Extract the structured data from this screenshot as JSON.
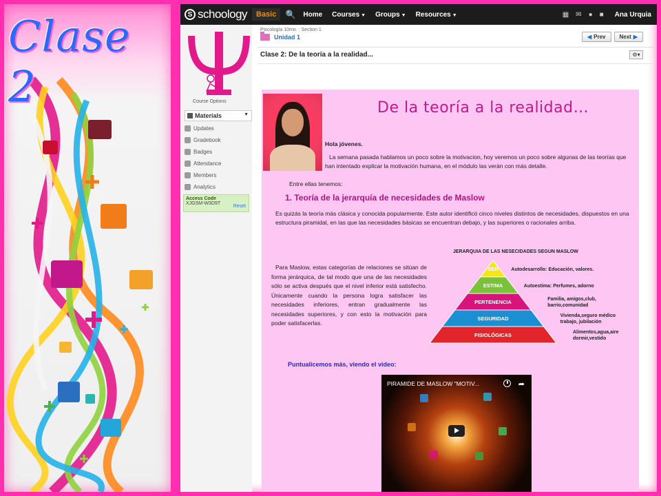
{
  "slide": {
    "title": "Clase 2"
  },
  "topbar": {
    "logo_mark": "S",
    "logo_text": "schoology",
    "basic_label": "Basic",
    "nav": [
      {
        "label": "Home",
        "has_caret": false
      },
      {
        "label": "Courses",
        "has_caret": true
      },
      {
        "label": "Groups",
        "has_caret": true
      },
      {
        "label": "Resources",
        "has_caret": true
      }
    ],
    "user_name": "Ana Urquia"
  },
  "sidebar": {
    "course_options": "Course Options",
    "materials": "Materials",
    "items": [
      "Updates",
      "Gradebook",
      "Badges",
      "Attendance",
      "Members",
      "Analytics"
    ],
    "access_label": "Access Code",
    "access_code": "XJGSM-W3D9T",
    "reset": "Reset"
  },
  "header": {
    "breadcrumb": "Psicología 10mo. : Section 1",
    "unit": "Unidad 1",
    "prev": "Prev",
    "next": "Next",
    "page_title": "Clase 2: De la teoría a la realidad..."
  },
  "content": {
    "title": "De la teoría a la realidad…",
    "greeting": "Hola jóvenes.",
    "intro": "La semana pasada hablamos un poco sobre la motivacion, hoy veremos un poco sobre algunas de las teorías  que han intentado explicar la motivación humana, en el módulo las verán con más detalle.",
    "entre": "Entre ellas tenemos:",
    "heading_1": "1.    Teoría de la jerarquía de necesidades de Maslow",
    "para_1": "Es quizás la teoría más clásica y conocida popularmente.  Este autor identificó cinco niveles distintos de necesidades, dispuestos en una estructura piramidal, en las que las necesidades básicas se encuentran debajo, y las superiores o racionales arriba.",
    "para_2": "Para Maslow, estas categorías de relaciones se sitúan de forma jerárquica, de tal modo que una de las necesidades sólo se activa después que el nivel inferior está satisfecho.  Únicamente cuando la persona logra satisfacer las necesidades inferiores, entran gradualmente las necesidades superiores, y con esto la motivación para poder satisfacerlas.",
    "video_call": "Puntualicemos más, viendo el video:",
    "video_title": "PIRAMIDE DE MASLOW \"MOTIV..."
  },
  "pyramid": {
    "title": "JERARQUIA DE LAS NESECIDADES SEGUN MASLOW",
    "levels": [
      {
        "name": "SER",
        "color": "#f7e51b",
        "desc": [
          "Autodesarrollo: Educación, valores."
        ]
      },
      {
        "name": "ESTIMA",
        "color": "#7ac23a",
        "desc": [
          "Autoestima: Perfumes, adorno"
        ]
      },
      {
        "name": "PERTENENCIA",
        "color": "#d8137b",
        "desc": [
          "Familia, amigos,club,",
          "barrio,comunidad"
        ]
      },
      {
        "name": "SEGURIDAD",
        "color": "#1c8fd3",
        "desc": [
          "Vivienda,seguro médico",
          "trabajo, jubilación"
        ]
      },
      {
        "name": "FISIOLÓGICAS",
        "color": "#e2252b",
        "desc": [
          "Alimentos,agua,aire",
          "dormir,vestido"
        ]
      }
    ]
  },
  "colors": {
    "frame": "#ff2fb0",
    "content_bg": "#fec6f2",
    "title_color": "#c2188b",
    "link_blue": "#2469c4"
  }
}
